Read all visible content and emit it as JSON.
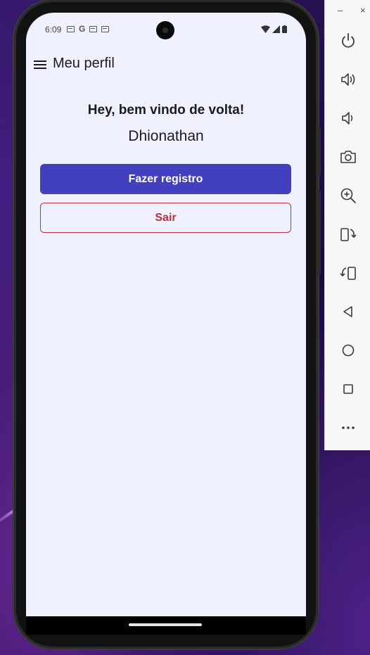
{
  "status_bar": {
    "time": "6:09"
  },
  "app_bar": {
    "title": "Meu perfil",
    "menu_icon": "hamburger-menu-icon"
  },
  "profile": {
    "greeting": "Hey, bem vindo de volta!",
    "username": "Dhionathan"
  },
  "actions": {
    "register_label": "Fazer registro",
    "logout_label": "Sair"
  },
  "emulator_toolbar": {
    "minimize_label": "–",
    "close_label": "×",
    "tools": [
      "power-icon",
      "volume-up-icon",
      "volume-down-icon",
      "camera-icon",
      "zoom-in-icon",
      "rotate-left-icon",
      "rotate-right-icon",
      "back-icon",
      "home-icon",
      "overview-icon",
      "more-icon"
    ]
  },
  "colors": {
    "primary": "#4340c0",
    "danger": "#c22d3c",
    "screen_background": "#eff2fe"
  }
}
